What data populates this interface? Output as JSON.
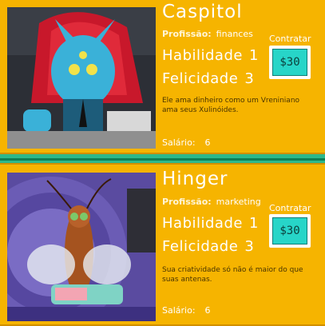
{
  "candidates": [
    {
      "name": "Caspitol",
      "profession_label": "Profissão:",
      "profession": "finances",
      "skill_label": "Habilidade",
      "skill": "1",
      "happiness_label": "Felicidade",
      "happiness": "3",
      "hire_label": "Contratar",
      "price": "$30",
      "description": "Ele ama dinheiro como um Vreniniano ama seus Xulinóides.",
      "salary_label": "Salário:",
      "salary": "6",
      "portrait_icon": "blue-alien-banker-icon"
    },
    {
      "name": "Hinger",
      "profession_label": "Profissão:",
      "profession": "marketing",
      "skill_label": "Habilidade",
      "skill": "1",
      "happiness_label": "Felicidade",
      "happiness": "3",
      "hire_label": "Contratar",
      "price": "$30",
      "description": "Sua criatividade só não é maior do que suas antenas.",
      "salary_label": "Salário:",
      "salary": "6",
      "portrait_icon": "cockroach-marketer-icon"
    }
  ],
  "colors": {
    "card_bg": "#f6b400",
    "separator": "#2db88a",
    "button_screen": "#27d5c8"
  }
}
